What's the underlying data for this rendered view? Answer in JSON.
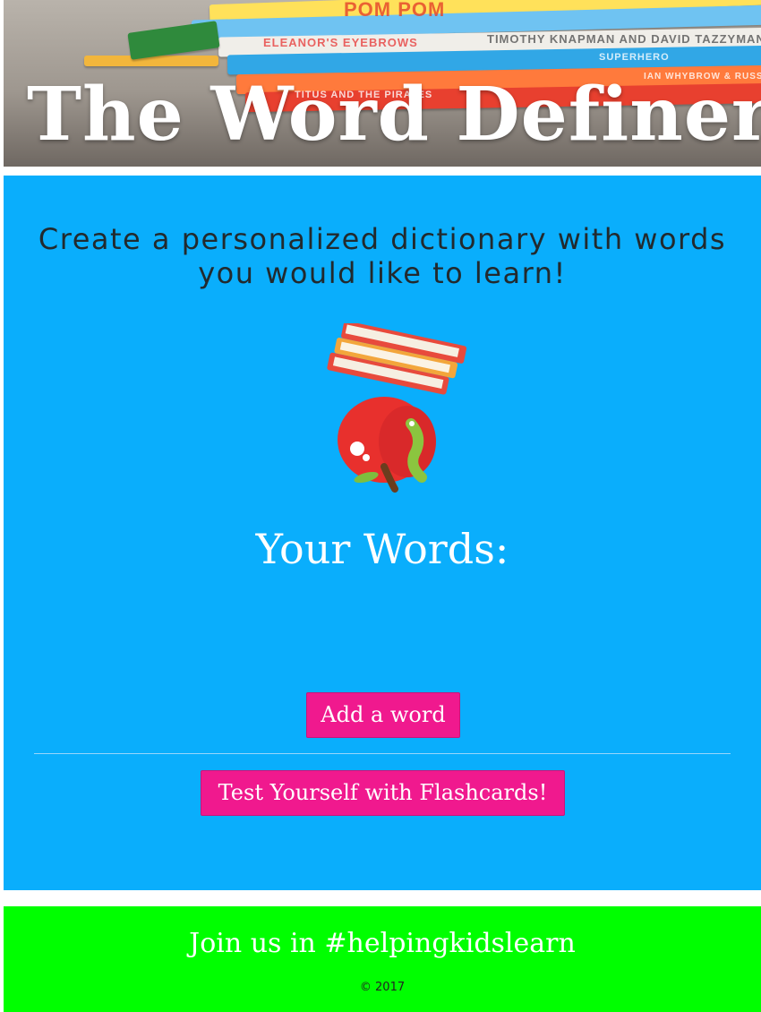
{
  "header": {
    "title": "The Word Definer",
    "book_spines": [
      "POM POM",
      "ELEANOR'S EYEBROWS",
      "TIMOTHY KNAPMAN AND DAVID TAZZYMAN",
      "IAN WHYBROW & RUSSELL AYTO",
      "SUPERHERO",
      "TITUS AND THE PIRATES"
    ]
  },
  "main": {
    "tagline": "Create a personalized dictionary with words you would like to learn!",
    "your_words_heading": "Your Words:",
    "add_word_label": "Add a word",
    "flashcards_label": "Test Yourself with Flashcards!"
  },
  "footer": {
    "message": "Join us in #helpingkidslearn",
    "copyright": "© 2017"
  },
  "colors": {
    "main_bg": "#0aaefc",
    "button_bg": "#f0198e",
    "footer_bg": "#00ff00"
  },
  "icons": [
    "books-apple-mascot-icon"
  ]
}
